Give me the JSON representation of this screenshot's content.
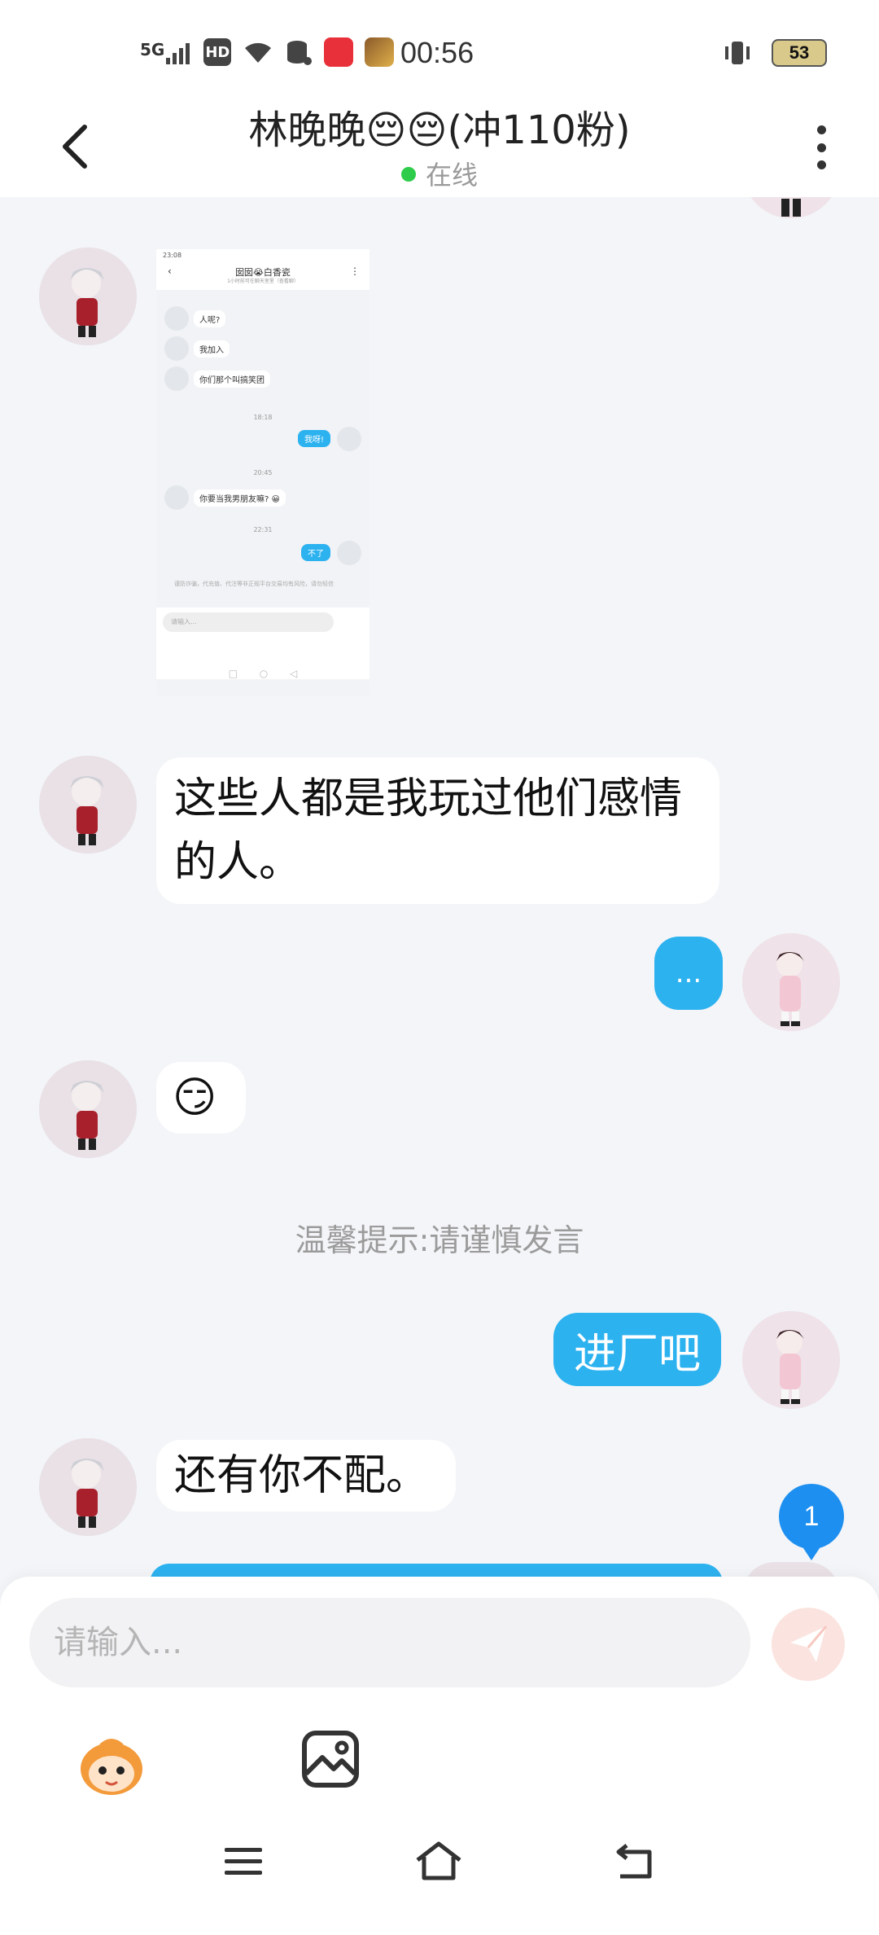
{
  "status_bar": {
    "network": "5G",
    "hd": "HD",
    "time": "00:56",
    "battery": "53"
  },
  "header": {
    "title": "林晚晚😔😔(冲110粉)",
    "online_status": "在线"
  },
  "screenshot": {
    "time": "23:08",
    "title": "囡囡😭白香瓷",
    "subtitle": "1小时前可在聊天室里（查看聊）",
    "msg1": "人呢?",
    "msg2": "我加入",
    "msg3": "你们那个叫搞笑团",
    "ts1": "18:18",
    "out1": "我呀!",
    "ts2": "20:45",
    "msg4": "你要当我男朋友嘛? 😀",
    "ts3": "22:31",
    "out2": "不了",
    "warning": "谨防诈骗，代充值、代注等非正规平台交易均有风险，请勿轻信",
    "input_placeholder": "请输入..."
  },
  "messages": {
    "m2_text": "这些人都是我玩过他们感情的人。",
    "m3_text": "...",
    "m4_emoji": "😏",
    "system_tip": "温馨提示:请谨慎发言",
    "m5_text": "进厂吧",
    "m6_text": "还有你不配。"
  },
  "unread_badge": "1",
  "composer": {
    "placeholder": "请输入..."
  },
  "colors": {
    "accent_blue": "#2db2f0",
    "background": "#f3f5f8",
    "online_green": "#2ecc4a"
  },
  "icons": {
    "back": "back-arrow-icon",
    "more": "more-vertical-icon",
    "send": "send-icon",
    "emoji": "mascot-emoji-icon",
    "image": "image-icon",
    "menu": "menu-icon",
    "home": "home-icon",
    "return": "return-icon"
  }
}
